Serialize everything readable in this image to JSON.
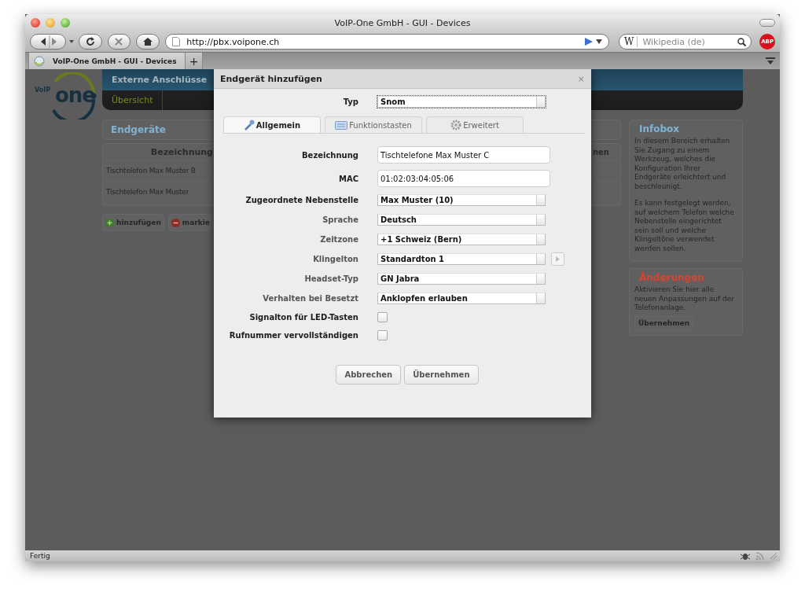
{
  "browser": {
    "title": "VoIP-One GmbH - GUI - Devices",
    "url": "http://pbx.voipone.ch",
    "search_engine": "W",
    "search_placeholder": "Wikipedia (de)",
    "adblock": "ABP",
    "tabs": [
      {
        "label": "VoIP-One GmbH - GUI - Devices",
        "selected": true
      }
    ],
    "new_tab": "+",
    "status": "Fertig"
  },
  "page": {
    "logo_small": "VoIP",
    "logo": "one",
    "nav": [
      "Externe Anschlüsse"
    ],
    "sub_nav": [
      {
        "label": "Übersicht",
        "selected": true
      }
    ],
    "section_title": "Endgeräte",
    "table": {
      "columns": [
        "Bezeichnung",
        "nen"
      ],
      "rows": [
        [
          "Tischtelefon Max Muster B"
        ],
        [
          "Tischtelefon Max Muster"
        ]
      ]
    },
    "actions": [
      {
        "kind": "add",
        "label": "hinzufügen"
      },
      {
        "kind": "remove",
        "label": "markie"
      }
    ],
    "infobox": {
      "title": "Infobox",
      "paragraphs": [
        "In diesem Bereich erhalten Sie Zugang zu einem Werkzeug, welches die Konfiguration Ihrer Endgeräte erleichtert und beschleunigt.",
        "Es kann festgelegt werden, auf welchem Telefon welche Nebenstelle eingerichtet sein soll und welche Klingeltöne verwendet werden sollen."
      ]
    },
    "changes": {
      "title": "Änderungen",
      "text": "Aktivieren Sie hier alle neuen Anpassungen auf der Telefonanlage.",
      "button": "Übernehmen"
    }
  },
  "dialog": {
    "title": "Endgerät hinzufügen",
    "close": "×",
    "type": {
      "label": "Typ",
      "value": "Snom"
    },
    "tabs": [
      {
        "label": "Allgemein",
        "selected": true
      },
      {
        "label": "Funktionstasten",
        "selected": false
      },
      {
        "label": "Erweitert",
        "selected": false
      }
    ],
    "fields": [
      {
        "kind": "text",
        "label": "Bezeichnung",
        "strong": true,
        "value": "Tischtelefone Max Muster C"
      },
      {
        "kind": "text",
        "label": "MAC",
        "strong": true,
        "value": "01:02:03:04:05:06"
      },
      {
        "kind": "select",
        "label": "Zugeordnete Nebenstelle",
        "strong": true,
        "value": "Max Muster (10)"
      },
      {
        "kind": "select",
        "label": "Sprache",
        "strong": false,
        "value": "Deutsch"
      },
      {
        "kind": "select",
        "label": "Zeitzone",
        "strong": false,
        "value": "+1 Schweiz (Bern)"
      },
      {
        "kind": "select-play",
        "label": "Klingelton",
        "strong": false,
        "value": "Standardton 1"
      },
      {
        "kind": "select",
        "label": "Headset-Typ",
        "strong": false,
        "value": "GN Jabra"
      },
      {
        "kind": "select",
        "label": "Verhalten bei Besetzt",
        "strong": false,
        "value": "Anklopfen erlauben"
      },
      {
        "kind": "checkbox",
        "label": "Signalton für LED-Tasten",
        "strong": true,
        "checked": false
      },
      {
        "kind": "checkbox",
        "label": "Rufnummer vervollständigen",
        "strong": true,
        "checked": false
      }
    ],
    "buttons": [
      "Abbrechen",
      "Übernehmen"
    ]
  }
}
